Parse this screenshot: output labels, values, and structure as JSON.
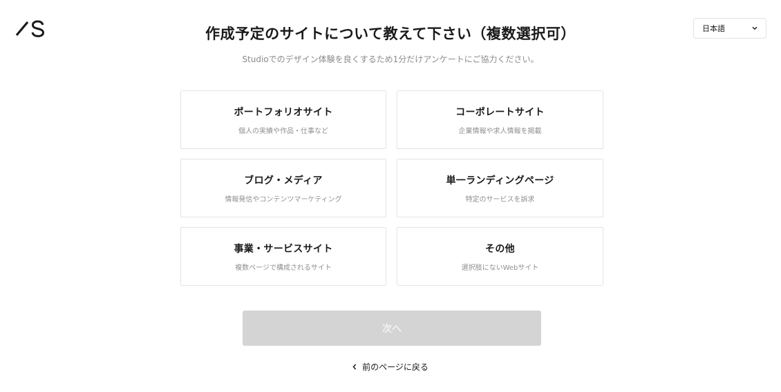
{
  "header": {
    "logo_icon": "studio-logo-icon",
    "language": {
      "selected": "日本語",
      "icon": "chevron-down-icon"
    }
  },
  "main": {
    "title": "作成予定のサイトについて教えて下さい（複数選択可）",
    "subtitle": "Studioでのデザイン体験を良くするため1分だけアンケートにご協力ください。",
    "options": [
      {
        "title": "ポートフォリオサイト",
        "description": "個人の実績や作品・仕事など"
      },
      {
        "title": "コーポレートサイト",
        "description": "企業情報や求人情報を掲載"
      },
      {
        "title": "ブログ・メディア",
        "description": "情報発信やコンテンツマーケティング"
      },
      {
        "title": "単一ランディングページ",
        "description": "特定のサービスを訴求"
      },
      {
        "title": "事業・サービスサイト",
        "description": "複数ページで構成されるサイト"
      },
      {
        "title": "その他",
        "description": "選択肢にないWebサイト"
      }
    ],
    "next_label": "次へ",
    "back_label": "前のページに戻る",
    "back_icon": "chevron-left-icon"
  },
  "colors": {
    "card_border": "#e4e4e4",
    "disabled_button_bg": "#d4d4d4",
    "muted_text": "#8a8a8a"
  }
}
